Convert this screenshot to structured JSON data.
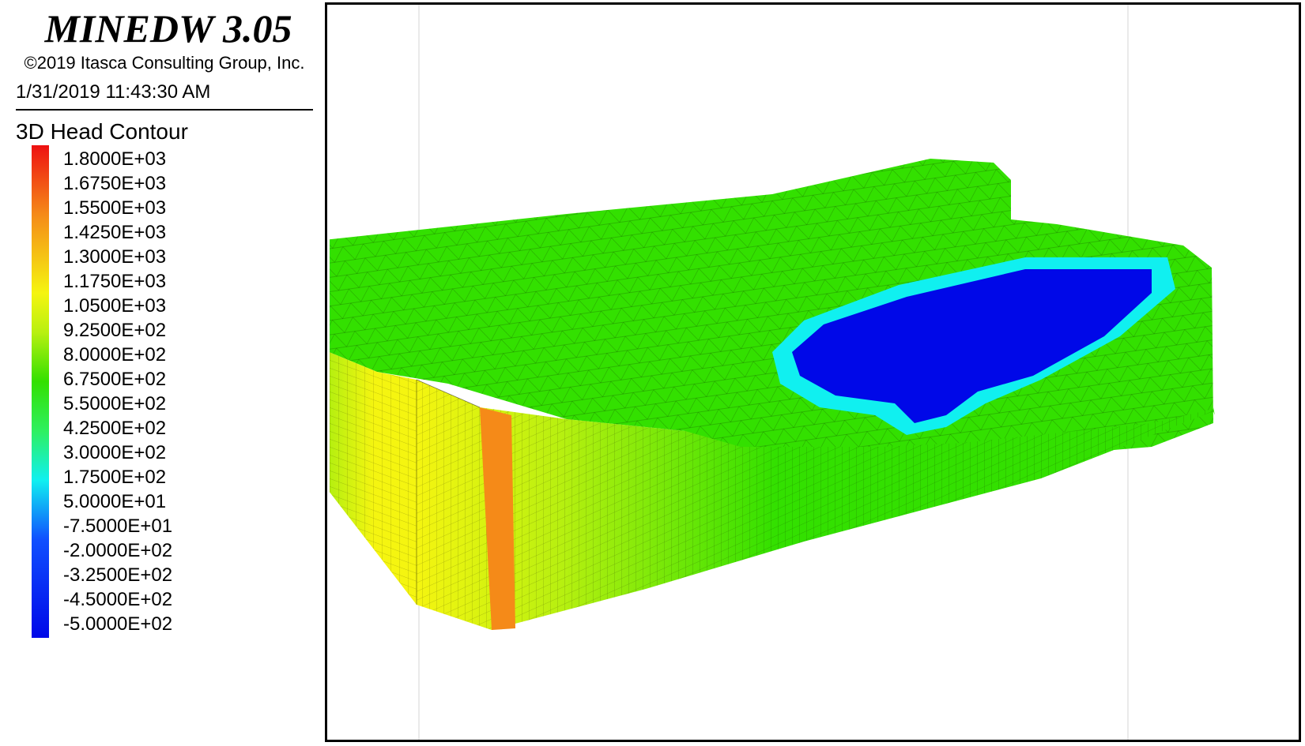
{
  "app": {
    "title": "MINEDW 3.05",
    "copyright": "©2019 Itasca Consulting Group, Inc.",
    "timestamp": "1/31/2019 11:43:30 AM"
  },
  "legend": {
    "title": "3D Head Contour",
    "labels": [
      "1.8000E+03",
      "1.6750E+03",
      "1.5500E+03",
      "1.4250E+03",
      "1.3000E+03",
      "1.1750E+03",
      "1.0500E+03",
      "9.2500E+02",
      "8.0000E+02",
      "6.7500E+02",
      "5.5000E+02",
      "4.2500E+02",
      "3.0000E+02",
      "1.7500E+02",
      "5.0000E+01",
      "-7.5000E+01",
      "-2.0000E+02",
      "-3.2500E+02",
      "-4.5000E+02",
      "-5.0000E+02"
    ],
    "colors": {
      "top": "#ee1111",
      "orange": "#f58a18",
      "yellow": "#f5f510",
      "yellow_green": "#b8f010",
      "green": "#33e000",
      "light_green": "#2ef060",
      "cyan": "#10f0f0",
      "blue": "#1050ff",
      "bottom": "#0008e8"
    }
  }
}
